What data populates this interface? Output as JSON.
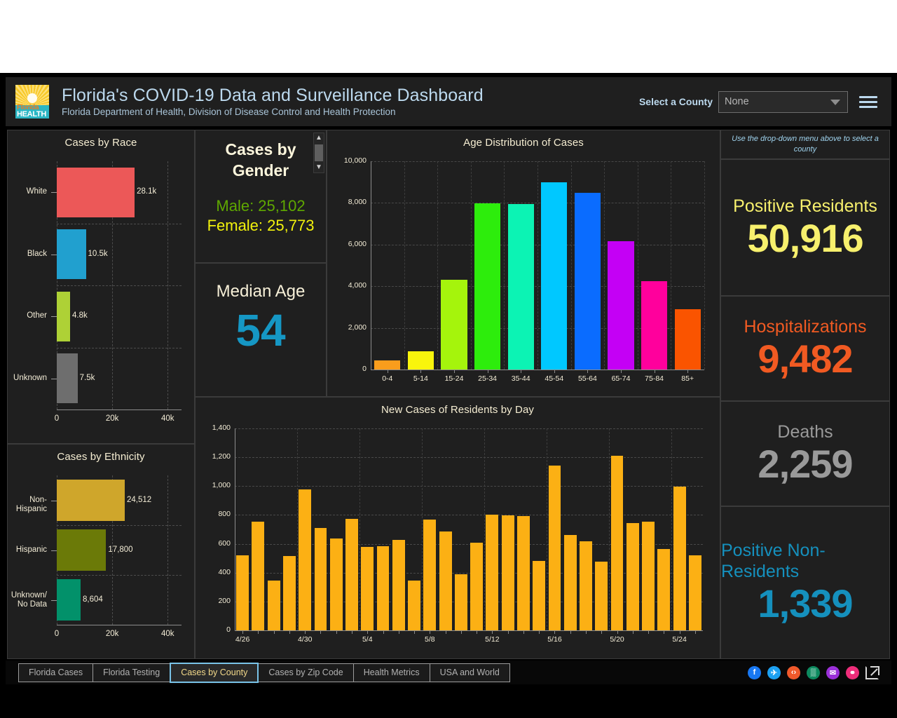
{
  "header": {
    "title": "Florida's COVID-19 Data and Surveillance Dashboard",
    "subtitle": "Florida Department of Health, Division of Disease Control and Health Protection",
    "logo_word_top": "Florida",
    "logo_word_bottom": "HEALTH",
    "county_label": "Select a County",
    "county_value": "None",
    "menu_icon": "hamburger-icon"
  },
  "note": {
    "text": "Use the drop-down menu above to select a county"
  },
  "gender": {
    "title": "Cases by Gender",
    "male": "Male: 25,102",
    "female": "Female: 25,773",
    "male_color": "#5fa800",
    "female_color": "#f2f20c"
  },
  "median_age": {
    "label": "Median Age",
    "value": "54",
    "color": "#1597c4"
  },
  "metrics": [
    {
      "label": "Positive Residents",
      "value": "50,916",
      "color": "#f7f06d"
    },
    {
      "label": "Hospitalizations",
      "value": "9,482",
      "color": "#f15a22"
    },
    {
      "label": "Deaths",
      "value": "2,259",
      "color": "#9a9a9a"
    },
    {
      "label": "Positive Non-Residents",
      "value": "1,339",
      "color": "#1590bd"
    }
  ],
  "footer": {
    "tabs": [
      {
        "label": "Florida Cases",
        "active": false
      },
      {
        "label": "Florida Testing",
        "active": false
      },
      {
        "label": "Cases by County",
        "active": true
      },
      {
        "label": "Cases by Zip Code",
        "active": false
      },
      {
        "label": "Health Metrics",
        "active": false
      },
      {
        "label": "USA and World",
        "active": false
      }
    ],
    "social": [
      {
        "name": "facebook-icon",
        "glyph": "f",
        "color": "#1878f3"
      },
      {
        "name": "twitter-icon",
        "glyph": "✈",
        "color": "#1da1f2"
      },
      {
        "name": "embed-code-icon",
        "glyph": "‹›",
        "color": "#f0592b"
      },
      {
        "name": "qr-code-icon",
        "glyph": "▒",
        "color": "#0d8a5f"
      },
      {
        "name": "email-icon",
        "glyph": "✉",
        "color": "#9b30d9"
      },
      {
        "name": "link-icon",
        "glyph": "⚭",
        "color": "#ee2d7a"
      }
    ],
    "external_link_icon": "external-link-icon"
  },
  "chart_data": [
    {
      "type": "bar",
      "id": "cases-by-race",
      "title": "Cases by Race",
      "orientation": "horizontal",
      "categories": [
        "White",
        "Black",
        "Other",
        "Unknown"
      ],
      "values": [
        28100,
        10500,
        4800,
        7500
      ],
      "data_labels": [
        "28.1k",
        "10.5k",
        "4.8k",
        "7.5k"
      ],
      "colors": [
        "#ec5858",
        "#21a0cf",
        "#aed136",
        "#6e6e6e"
      ],
      "xlabel": "",
      "ylabel": "",
      "xlim": [
        0,
        45000
      ],
      "xticks": [
        0,
        20000,
        40000
      ],
      "xticklabels": [
        "0",
        "20k",
        "40k"
      ],
      "grid": true,
      "legend": "none"
    },
    {
      "type": "bar",
      "id": "cases-by-ethnicity",
      "title": "Cases by Ethnicity",
      "orientation": "horizontal",
      "categories": [
        "Non-Hispanic",
        "Hispanic",
        "Unknown/ No Data"
      ],
      "values": [
        24512,
        17800,
        8604
      ],
      "data_labels": [
        "24,512",
        "17,800",
        "8,604"
      ],
      "colors": [
        "#cfa62b",
        "#6b7a08",
        "#02916a"
      ],
      "xlabel": "",
      "ylabel": "",
      "xlim": [
        0,
        45000
      ],
      "xticks": [
        0,
        20000,
        40000
      ],
      "xticklabels": [
        "0",
        "20k",
        "40k"
      ],
      "grid": true,
      "legend": "none"
    },
    {
      "type": "bar",
      "id": "age-distribution-of-cases",
      "title": "Age Distribution of Cases",
      "orientation": "vertical",
      "categories": [
        "0-4",
        "5-14",
        "15-24",
        "25-34",
        "35-44",
        "45-54",
        "55-64",
        "65-74",
        "75-84",
        "85+"
      ],
      "values": [
        430,
        860,
        4300,
        7980,
        7950,
        9000,
        8500,
        6150,
        4250,
        2900
      ],
      "colors": [
        "#f99d1c",
        "#f9f50c",
        "#a5f40c",
        "#2ded0c",
        "#0cf3b4",
        "#00c8ff",
        "#0a6cff",
        "#c400f5",
        "#ff009c",
        "#fa5400"
      ],
      "xlabel": "",
      "ylabel": "",
      "ylim": [
        0,
        10000
      ],
      "yticks": [
        0,
        2000,
        4000,
        6000,
        8000,
        10000
      ],
      "yticklabels": [
        "0",
        "2,000",
        "4,000",
        "6,000",
        "8,000",
        "10,000"
      ],
      "grid": true,
      "legend": "none"
    },
    {
      "type": "bar",
      "id": "new-cases-of-residents-by-day",
      "title": "New Cases of Residents by Day",
      "orientation": "vertical",
      "bar_color": "#fcb014",
      "categories": [
        "4/26",
        "4/27",
        "4/28",
        "4/29",
        "4/30",
        "5/1",
        "5/2",
        "5/3",
        "5/4",
        "5/5",
        "5/6",
        "5/7",
        "5/8",
        "5/9",
        "5/10",
        "5/11",
        "5/12",
        "5/13",
        "5/14",
        "5/15",
        "5/16",
        "5/17",
        "5/18",
        "5/19",
        "5/20",
        "5/21",
        "5/22",
        "5/23",
        "5/24",
        "5/25"
      ],
      "values": [
        520,
        755,
        345,
        515,
        978,
        708,
        635,
        775,
        580,
        583,
        628,
        345,
        770,
        685,
        390,
        610,
        802,
        797,
        792,
        483,
        1143,
        660,
        616,
        478,
        1208,
        742,
        755,
        565,
        997,
        520
      ],
      "xlabel": "",
      "ylabel": "",
      "ylim": [
        0,
        1400
      ],
      "yticks": [
        0,
        200,
        400,
        600,
        800,
        1000,
        1200,
        1400
      ],
      "yticklabels": [
        "0",
        "200",
        "400",
        "600",
        "800",
        "1,000",
        "1,200",
        "1,400"
      ],
      "xticklabels_shown": [
        "4/26",
        "4/30",
        "5/4",
        "5/8",
        "5/12",
        "5/16",
        "5/20",
        "5/24"
      ],
      "grid": true,
      "legend": "none"
    }
  ]
}
